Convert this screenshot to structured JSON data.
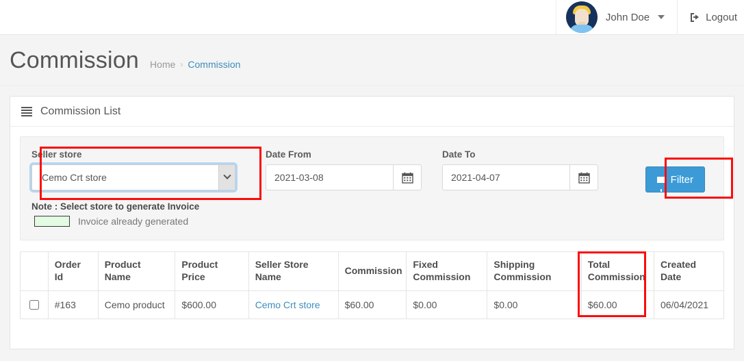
{
  "navbar": {
    "user_name": "John Doe",
    "user_caret_icon": "chevron-down-icon",
    "avatar_icon": "user-avatar",
    "logout_label": "Logout",
    "logout_icon": "logout-icon"
  },
  "page": {
    "title": "Commission",
    "breadcrumb": {
      "home_label": "Home",
      "separator": "›",
      "current_label": "Commission"
    }
  },
  "panel": {
    "icon": "list-icon",
    "title": "Commission List"
  },
  "filter": {
    "seller_store": {
      "label": "Seller store",
      "selected": "Cemo Crt store",
      "arrow_icon": "chevron-down-icon"
    },
    "date_from": {
      "label": "Date From",
      "value": "2021-03-08",
      "placeholder": "Date From",
      "calendar_icon": "calendar-icon"
    },
    "date_to": {
      "label": "Date To",
      "value": "2021-04-07",
      "placeholder": "Date To",
      "calendar_icon": "calendar-icon"
    },
    "filter_button": {
      "label": "Filter",
      "icon": "funnel-icon",
      "color": "#3c9bd6"
    },
    "note": {
      "title": "Note : Select store to generate Invoice",
      "legend_text": "Invoice already generated",
      "legend_color": "#e2fbe2"
    }
  },
  "table": {
    "columns": [
      "",
      "Order Id",
      "Product Name",
      "Product Price",
      "Seller Store Name",
      "Commission",
      "Fixed Commission",
      "Shipping Commission",
      "Total Commission",
      "Created Date"
    ],
    "rows": [
      {
        "checkbox": false,
        "order_id": "#163",
        "product_name": "Cemo product",
        "product_price": "$600.00",
        "seller_store_name": "Cemo Crt store",
        "commission": "$60.00",
        "fixed_commission": "$0.00",
        "shipping_commission": "$0.00",
        "total_commission": "$60.00",
        "created_date": "06/04/2021"
      }
    ]
  },
  "annotations": {
    "color": "#fb0b0b",
    "boxes": [
      "seller-store-field",
      "filter-button",
      "total-commission-column"
    ]
  }
}
